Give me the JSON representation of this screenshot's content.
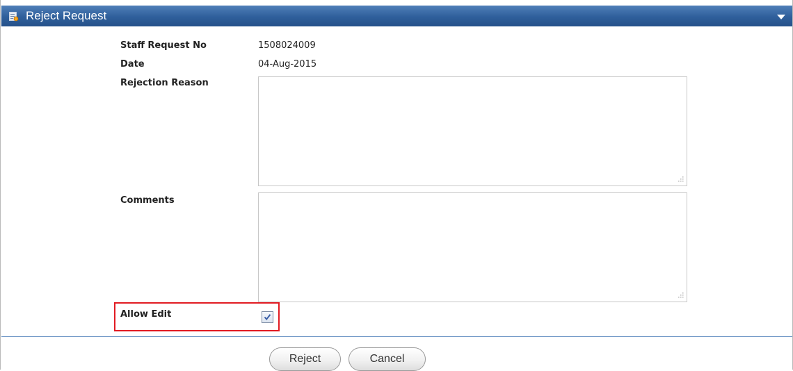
{
  "panel": {
    "title": "Reject Request",
    "title_icon": "form-edit-icon",
    "collapse_icon": "chevron-down-icon"
  },
  "form": {
    "staff_request_no": {
      "label": "Staff Request No",
      "value": "1508024009"
    },
    "date": {
      "label": "Date",
      "value": "04-Aug-2015"
    },
    "rejection_reason": {
      "label": "Rejection Reason",
      "value": ""
    },
    "comments": {
      "label": "Comments",
      "value": ""
    },
    "allow_edit": {
      "label": "Allow Edit",
      "checked": true
    }
  },
  "buttons": {
    "reject": "Reject",
    "cancel": "Cancel"
  },
  "colors": {
    "titlebar": "#2f5f9b",
    "highlight_border": "#e11b22",
    "divider": "#6e96c6"
  }
}
